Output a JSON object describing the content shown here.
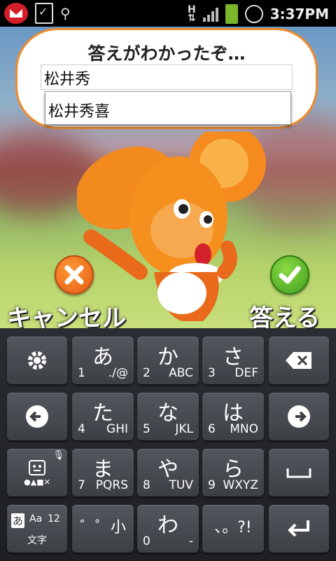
{
  "status_bar": {
    "time": "3:37PM",
    "network": "H"
  },
  "scene": {
    "prompt": "答えがわかったぞ…",
    "input_value": "松井秀",
    "suggestion": "松井秀喜",
    "cancel_label": "キャンセル",
    "answer_label": "答える"
  },
  "keyboard": {
    "keys": [
      {
        "main": "あ",
        "num": "1",
        "sub": "./@"
      },
      {
        "main": "か",
        "num": "2",
        "sub": "ABC"
      },
      {
        "main": "さ",
        "num": "3",
        "sub": "DEF"
      },
      {
        "main": "た",
        "num": "4",
        "sub": "GHI"
      },
      {
        "main": "な",
        "num": "5",
        "sub": "JKL"
      },
      {
        "main": "は",
        "num": "6",
        "sub": "MNO"
      },
      {
        "main": "ま",
        "num": "7",
        "sub": "PQRS"
      },
      {
        "main": "や",
        "num": "8",
        "sub": "TUV"
      },
      {
        "main": "ら",
        "num": "9",
        "sub": "WXYZ"
      },
      {
        "main": "゛゜小",
        "num": "",
        "sub": ""
      },
      {
        "main": "わ",
        "num": "0",
        "sub": "-"
      },
      {
        "main": "、。?!",
        "num": "",
        "sub": ""
      }
    ],
    "mode_key": {
      "kana": "あ",
      "alpha": "Aa",
      "num": "12",
      "label": "文字"
    },
    "emoji_symbols": "●▲■✕"
  },
  "colors": {
    "bubble_border": "#ef8a2a",
    "cancel": "#e45a10",
    "ok": "#3f9d1c"
  }
}
